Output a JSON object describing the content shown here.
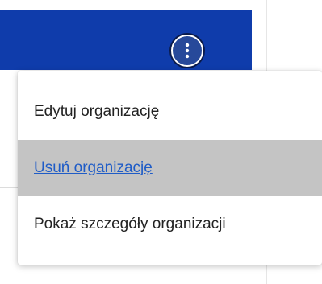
{
  "header": {
    "kebab_icon": "more-vertical-icon",
    "accent_color": "#0f3cab"
  },
  "menu": {
    "items": [
      {
        "label": "Edytuj organizację",
        "state": "normal"
      },
      {
        "label": "Usuń organizację",
        "state": "hover",
        "color": "#1f5cc7"
      },
      {
        "label": "Pokaż szczegóły organizacji",
        "state": "normal"
      }
    ]
  }
}
